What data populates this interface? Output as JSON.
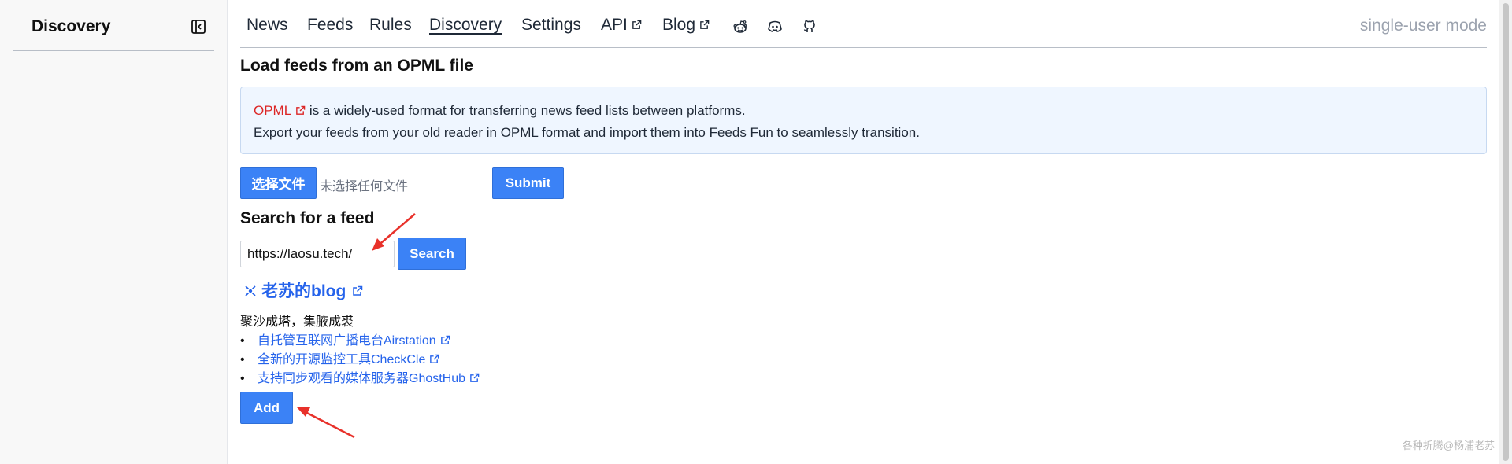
{
  "sidebar": {
    "title": "Discovery",
    "collapse_icon": "sidebar-collapse-icon"
  },
  "nav": {
    "items": [
      {
        "label": "News",
        "external": false
      },
      {
        "label": "Feeds",
        "external": false
      },
      {
        "label": "Rules",
        "external": false
      },
      {
        "label": "Discovery",
        "external": false,
        "active": true
      },
      {
        "label": "Settings",
        "external": false
      },
      {
        "label": "API",
        "external": true
      },
      {
        "label": "Blog",
        "external": true
      }
    ],
    "social_icons": [
      "reddit-icon",
      "discord-icon",
      "github-icon"
    ],
    "mode": "single-user mode"
  },
  "opml": {
    "heading": "Load feeds from an OPML file",
    "link_text": "OPML",
    "line1_rest": "is a widely-used format for transferring news feed lists between platforms.",
    "line2": "Export your feeds from your old reader in OPML format and import them into Feeds Fun to seamlessly transition.",
    "choose_file_label": "选择文件",
    "file_status": "未选择任何文件",
    "submit_label": "Submit"
  },
  "search": {
    "heading": "Search for a feed",
    "input_value": "https://laosu.tech/",
    "button_label": "Search"
  },
  "result": {
    "title": "老苏的blog",
    "description": "聚沙成塔，集腋成裘",
    "entries": [
      "自托管互联网广播电台Airstation",
      "全新的开源监控工具CheckCle",
      "支持同步观看的媒体服务器GhostHub"
    ],
    "add_label": "Add"
  },
  "watermark": "各种折腾@杨浦老苏",
  "colors": {
    "accent": "#3b82f6",
    "link": "#2563eb",
    "opml_link": "#dc2626",
    "info_bg": "#eff6ff",
    "annotation_arrow": "#e8312a"
  }
}
